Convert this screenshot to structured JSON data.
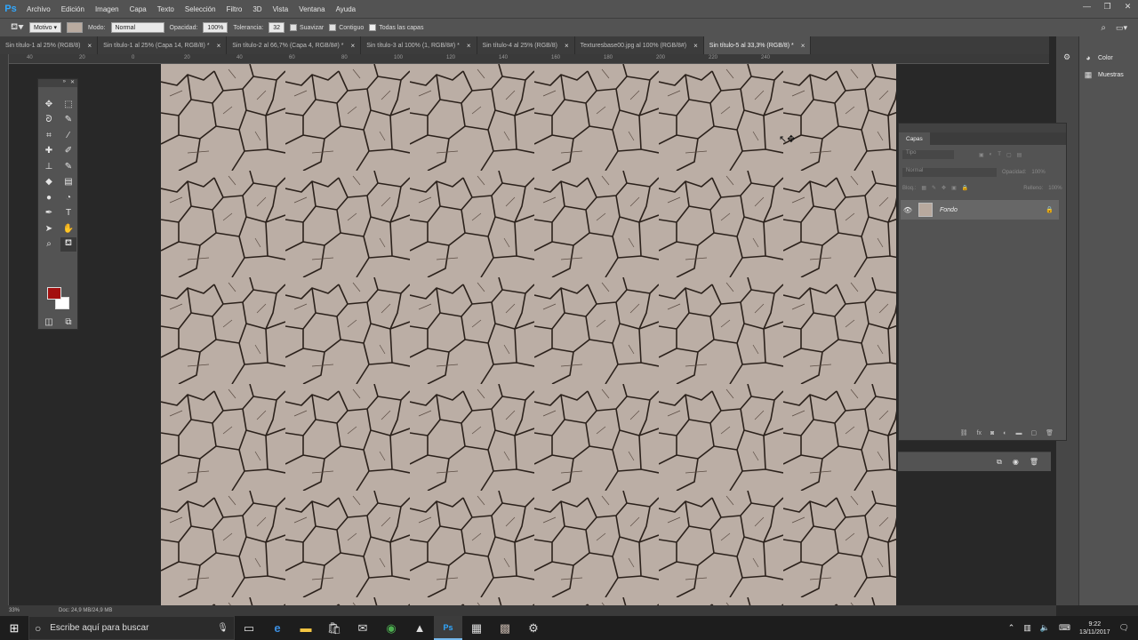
{
  "app": {
    "logo": "Ps",
    "title": "Adobe Photoshop"
  },
  "menu": [
    "Archivo",
    "Edición",
    "Imagen",
    "Capa",
    "Texto",
    "Selección",
    "Filtro",
    "3D",
    "Vista",
    "Ventana",
    "Ayuda"
  ],
  "window_controls": {
    "minimize": "—",
    "restore": "❐",
    "close": "✕"
  },
  "options": {
    "mode_label": "Modo:",
    "mode_value": "Normal",
    "source_value": "Motivo",
    "opacity_label": "Opacidad:",
    "opacity_value": "100%",
    "tolerance_label": "Tolerancia:",
    "tolerance_value": "32",
    "smooth_label": "Suavizar",
    "contiguous_label": "Contiguo",
    "all_layers_label": "Todas las capas"
  },
  "tabs": [
    {
      "label": "Sin título-1 al 25% (RGB/8)",
      "active": false
    },
    {
      "label": "Sin título-1 al 25% (Capa 14, RGB/8) *",
      "active": false
    },
    {
      "label": "Sin título-2 al 66,7% (Capa 4, RGB/8#) *",
      "active": false
    },
    {
      "label": "Sin título-3 al 100% (1, RGB/8#) *",
      "active": false
    },
    {
      "label": "Sin título-4 al 25% (RGB/8)",
      "active": false
    },
    {
      "label": "Texturesbase00.jpg al 100% (RGB/8#)",
      "active": false
    },
    {
      "label": "Sin título-5 al 33,3% (RGB/8) *",
      "active": true
    }
  ],
  "ruler_labels": [
    "40",
    "20",
    "0",
    "20",
    "40",
    "60",
    "80",
    "100",
    "120",
    "140",
    "160",
    "180",
    "200",
    "220",
    "240"
  ],
  "tools": {
    "icons": [
      "move-icon",
      "marquee-icon",
      "lasso-icon",
      "quick-select-icon",
      "crop-icon",
      "eyedropper-icon",
      "spot-heal-icon",
      "brush-icon",
      "clone-stamp-icon",
      "history-brush-icon",
      "eraser-icon",
      "gradient-icon",
      "blur-icon",
      "dodge-icon",
      "pen-icon",
      "type-icon",
      "path-select-icon",
      "hand-icon",
      "zoom-icon",
      "paint-bucket-icon"
    ],
    "foreground_color": "#a3100f",
    "background_color": "#ffffff"
  },
  "dock": {
    "items": [
      {
        "label": "Color",
        "icon": "color-wheel-icon"
      },
      {
        "label": "Muestras",
        "icon": "swatches-icon"
      }
    ]
  },
  "layers": {
    "tab_label": "Capas",
    "filter_placeholder": "Tipo",
    "blend_mode": "Normal",
    "opacity_label": "Opacidad:",
    "opacity_value": "100%",
    "lock_label": "Bloq.:",
    "fill_label": "Relleno:",
    "fill_value": "100%",
    "layer_name": "Fondo"
  },
  "status": {
    "zoom": "33%",
    "doc": "Doc: 24,9 MB/24,9 MB"
  },
  "taskbar": {
    "search_placeholder": "Escribe aquí para buscar",
    "time": "9:22",
    "date": "13/11/2017"
  },
  "colors": {
    "accent": "#31a8ff",
    "panel": "#535353",
    "workspace": "#282828",
    "texture_base": "#b9aba2",
    "crack": "#2a1f19"
  }
}
